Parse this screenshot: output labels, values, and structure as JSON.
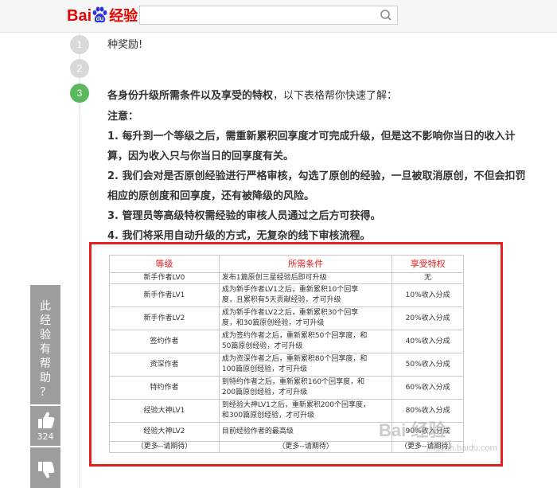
{
  "header": {
    "logo": {
      "bai": "Bai",
      "du": "du",
      "jingyan": "经验"
    },
    "search": {
      "placeholder": "",
      "value": ""
    },
    "search_icon": "search-icon"
  },
  "steps": [
    {
      "number": "1",
      "text": "种奖励!"
    },
    {
      "number": "2"
    },
    {
      "number": "3",
      "title_bold": "各身份升级所需条件以及享受的特权",
      "title_rest": "，以下表格帮你快速了解："
    }
  ],
  "note_label": "注意：",
  "notes": [
    "1. 每升到一个等级之后，需重新累积回享度才可完成升级，但是这不影响你当日的收入计",
    "算，因为收入只与你当日的回享度有关。",
    "2. 我们会对是否原创经验进行严格审核，勾选了原创的经验，一旦被取消原创，不但会扣罚",
    "相应的原创度和回享度，还有被降级的风险。",
    "3. 管理员等高级特权需经验的审核人员通过之后方可获得。",
    "4. 我们将采用自动升级的方式，无复杂的线下审核流程。"
  ],
  "table": {
    "headers": [
      "等级",
      "所需条件",
      "享受特权"
    ],
    "rows": [
      {
        "level": "新手作者LV0",
        "cond1": "发布1篇原创三星经验后即可升级",
        "cond2": "",
        "priv": "无"
      },
      {
        "level": "新手作者LV1",
        "cond1": "成为新手作者LV1之后，重新累积10个回享",
        "cond2": "度，且累积有5天贡献经验，才可升级",
        "priv": "10%收入分成"
      },
      {
        "level": "新手作者LV2",
        "cond1": "成为新手作者LV2之后，重新累积30个回享",
        "cond2": "度，和30篇原创经验，才可升级",
        "priv": "20%收入分成"
      },
      {
        "level": "签约作者",
        "cond1": "成为签约作者之后，重新累积50个回享度，和",
        "cond2": "50篇原创经验，才可升级",
        "priv": "40%收入分成"
      },
      {
        "level": "资深作者",
        "cond1": "成为资深作者之后，重新累积80个回享度，和",
        "cond2": "100篇原创经验，才可升级",
        "priv": "50%收入分成"
      },
      {
        "level": "特约作者",
        "cond1": "到特约作者之后，重新累积160个回享度，和",
        "cond2": "200篇原创经验，才可升级",
        "priv": "60%收入分成"
      },
      {
        "level": "经验大神LV1",
        "cond1": "到经验大神LV1之后，重新累积200个回享度，",
        "cond2": "和300篇原创经验，才可升级",
        "priv": "80%收入分成"
      },
      {
        "level": "经验大神LV2",
        "cond1": "目前经验作者的最高级",
        "cond2": "",
        "priv": "90%收入分成"
      },
      {
        "level": "（更多--请期待）",
        "cond1": "（更多--请期待）",
        "cond2": "",
        "priv": "（更多--请期待）"
      }
    ]
  },
  "watermark": {
    "main": "Bai 经验",
    "sub": "jingyan.baidu.com"
  },
  "side": {
    "question_chars": [
      "此",
      "经",
      "验",
      "有",
      "帮",
      "助",
      "？"
    ],
    "upvote_count": "324",
    "thumb_up_icon": "thumb-up-icon",
    "thumb_down_icon": "thumb-down-icon"
  }
}
